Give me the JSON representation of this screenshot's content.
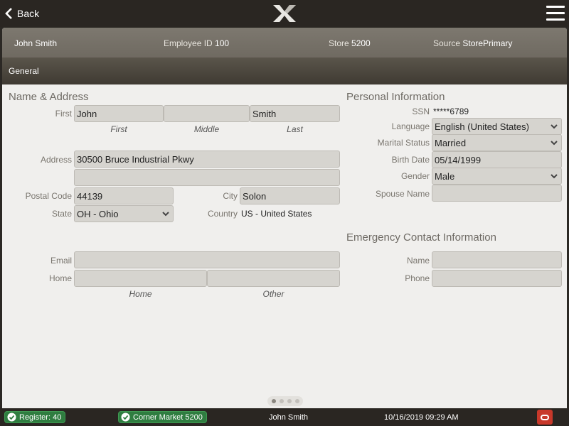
{
  "topbar": {
    "back_label": "Back",
    "logo_icon": "xstore-x-logo-icon",
    "menu_icon": "hamburger-menu-icon"
  },
  "employee": {
    "name": "John Smith",
    "employee_id_label": "Employee ID",
    "employee_id": "100",
    "store_label": "Store",
    "store": "5200",
    "source_label": "Source",
    "source": "StorePrimary"
  },
  "section": {
    "title": "General"
  },
  "name_address": {
    "heading": "Name & Address",
    "first_label": "First",
    "first_value": "John",
    "middle_value": "",
    "last_value": "Smith",
    "sub_first": "First",
    "sub_middle": "Middle",
    "sub_last": "Last",
    "address_label": "Address",
    "address1": "30500 Bruce Industrial Pkwy",
    "address2": "",
    "postal_label": "Postal Code",
    "postal_value": "44139",
    "city_label": "City",
    "city_value": "Solon",
    "state_label": "State",
    "state_value": "OH - Ohio",
    "country_label": "Country",
    "country_value": "US - United States",
    "email_label": "Email",
    "email_value": "",
    "home_label": "Home",
    "home_phone": "",
    "other_phone": "",
    "sub_home": "Home",
    "sub_other": "Other"
  },
  "personal": {
    "heading": "Personal Information",
    "ssn_label": "SSN",
    "ssn_value": "*****6789",
    "language_label": "Language",
    "language_value": "English (United States)",
    "marital_label": "Marital Status",
    "marital_value": "Married",
    "birth_label": "Birth Date",
    "birth_value": "05/14/1999",
    "gender_label": "Gender",
    "gender_value": "Male",
    "spouse_label": "Spouse Name",
    "spouse_value": ""
  },
  "emergency": {
    "heading": "Emergency Contact Information",
    "name_label": "Name",
    "name_value": "",
    "phone_label": "Phone",
    "phone_value": ""
  },
  "pager": {
    "pages": 4,
    "current": 1
  },
  "statusbar": {
    "register": "Register: 40",
    "store": "Corner Market 5200",
    "user": "John Smith",
    "datetime": "10/16/2019 09:29 AM"
  },
  "colors": {
    "topbar": "#2a2622",
    "panel": "#f0efed",
    "status_green": "#2f7d40",
    "oracle_red": "#c8382a"
  }
}
